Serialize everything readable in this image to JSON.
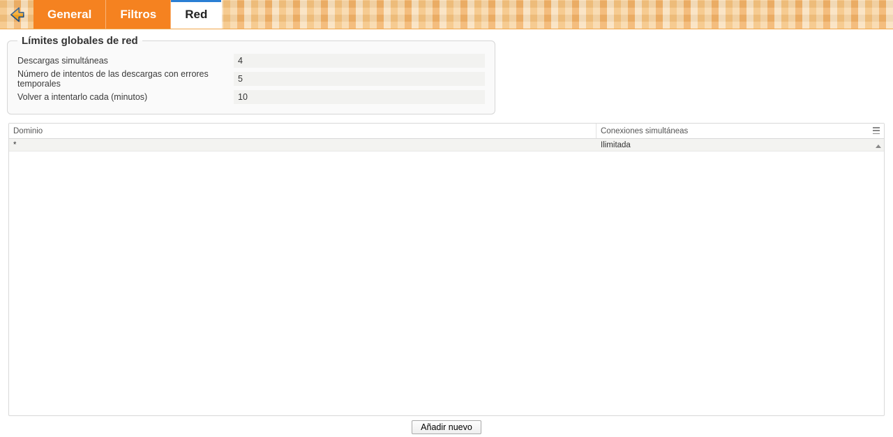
{
  "tabs": {
    "general": "General",
    "filtros": "Filtros",
    "red": "Red"
  },
  "global_limits": {
    "legend": "Límites globales de red",
    "fields": {
      "simultaneous_label": "Descargas simultáneas",
      "simultaneous_value": "4",
      "retries_label": "Número de intentos de las descargas con errores temporales",
      "retries_value": "5",
      "retry_every_label": "Volver a intentarlo cada (minutos)",
      "retry_every_value": "10"
    }
  },
  "table": {
    "headers": {
      "domain": "Dominio",
      "connections": "Conexiones simultáneas"
    },
    "rows": [
      {
        "domain": "*",
        "connections": "Ilimitada"
      }
    ]
  },
  "footer": {
    "add_new": "Añadir nuevo"
  }
}
